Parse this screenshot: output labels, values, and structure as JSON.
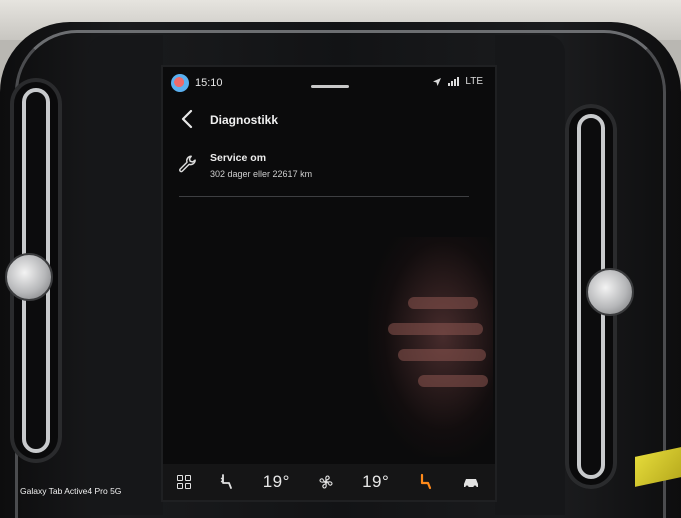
{
  "status_bar": {
    "time": "15:10",
    "network": "LTE",
    "icons": [
      "profile-avatar",
      "navigation-arrow-icon",
      "signal-icon"
    ]
  },
  "header": {
    "title": "Diagnostikk",
    "back_icon": "chevron-left-icon"
  },
  "service": {
    "title": "Service om",
    "detail": "302 dager eller 22617 km",
    "icon": "wrench-icon"
  },
  "climate_bar": {
    "driver_temp": "19°",
    "passenger_temp": "19°",
    "icons": [
      "grid-icon",
      "seat-heat-icon",
      "fan-icon",
      "seat-heat-active-icon",
      "car-defrost-icon"
    ],
    "accent_color": "#ff8a1a"
  },
  "watermark": "Galaxy Tab Active4 Pro 5G"
}
